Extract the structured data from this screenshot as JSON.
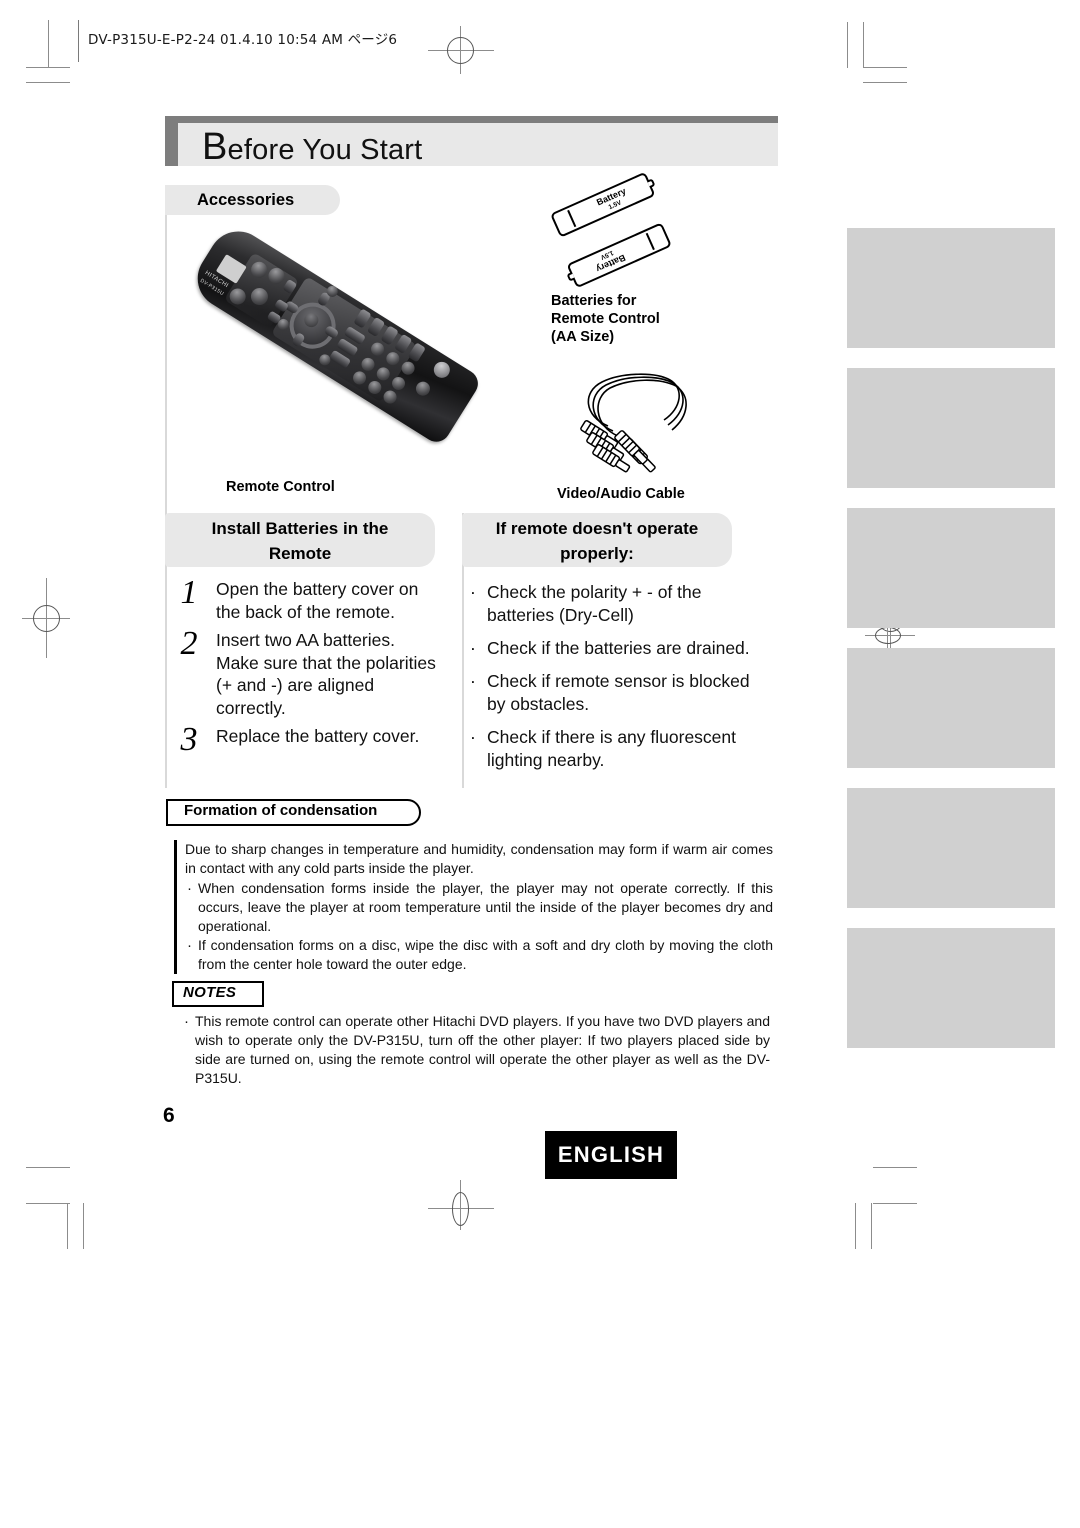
{
  "print_header": {
    "text": "DV-P315U-E-P2-24  01.4.10 10:54 AM  ページ6"
  },
  "title": {
    "initial": "B",
    "rest": "efore You Start"
  },
  "accessories": {
    "heading": "Accessories",
    "items": [
      {
        "caption": "Remote Control",
        "icon": "remote-control-illustration"
      },
      {
        "caption": "Batteries for\nRemote Control\n(AA Size)",
        "icon": "aa-batteries-illustration"
      },
      {
        "caption": "Video/Audio Cable",
        "icon": "rca-cable-illustration"
      }
    ],
    "battery_label": "Battery",
    "battery_voltage": "1.5V",
    "remote_brand": "HITACHI",
    "remote_model": "DV-P315U",
    "remote_logo": "DVD"
  },
  "install": {
    "heading": "Install Batteries in the\nRemote",
    "steps": [
      {
        "num": "1",
        "text": "Open the battery cover on the back of the remote."
      },
      {
        "num": "2",
        "text": "Insert two AA batteries. Make sure that the polarities (+ and -) are aligned correctly."
      },
      {
        "num": "3",
        "text": "Replace the battery cover."
      }
    ]
  },
  "troubleshoot": {
    "heading": "If remote doesn't operate\nproperly:",
    "bullets": [
      "Check the polarity + - of the batteries (Dry-Cell)",
      "Check if the batteries are drained.",
      "Check if remote sensor is blocked by obstacles.",
      "Check if there is any fluorescent lighting nearby."
    ]
  },
  "condensation": {
    "heading": "Formation of condensation",
    "intro": "Due to sharp changes in temperature and humidity, condensation may form if warm air comes in contact with any cold parts inside the player.",
    "bullets": [
      "When condensation forms inside the player, the player may not operate correctly. If this occurs, leave the player at room temperature until the inside of the player becomes dry and operational.",
      "If condensation forms on a disc, wipe the disc with a soft and dry cloth by moving the cloth from the center hole toward the outer edge."
    ]
  },
  "notes": {
    "heading": "NOTES",
    "bullets": [
      "This remote control can operate other Hitachi DVD players. If you have two DVD players and wish to operate only the DV-P315U, turn off the other player: If two players placed side by side are turned on, using the remote control will operate the other player as well as the DV-P315U."
    ]
  },
  "footer": {
    "page_number": "6",
    "language_badge": "ENGLISH"
  },
  "side_tabs": {
    "count": 6,
    "color": "#d0d0d0"
  },
  "colors": {
    "banner_bg": "#e8e8e8",
    "banner_bar": "#7d7d7d",
    "tab_gray": "#d0d0d0",
    "badge_bg": "#000000",
    "text": "#111111"
  }
}
